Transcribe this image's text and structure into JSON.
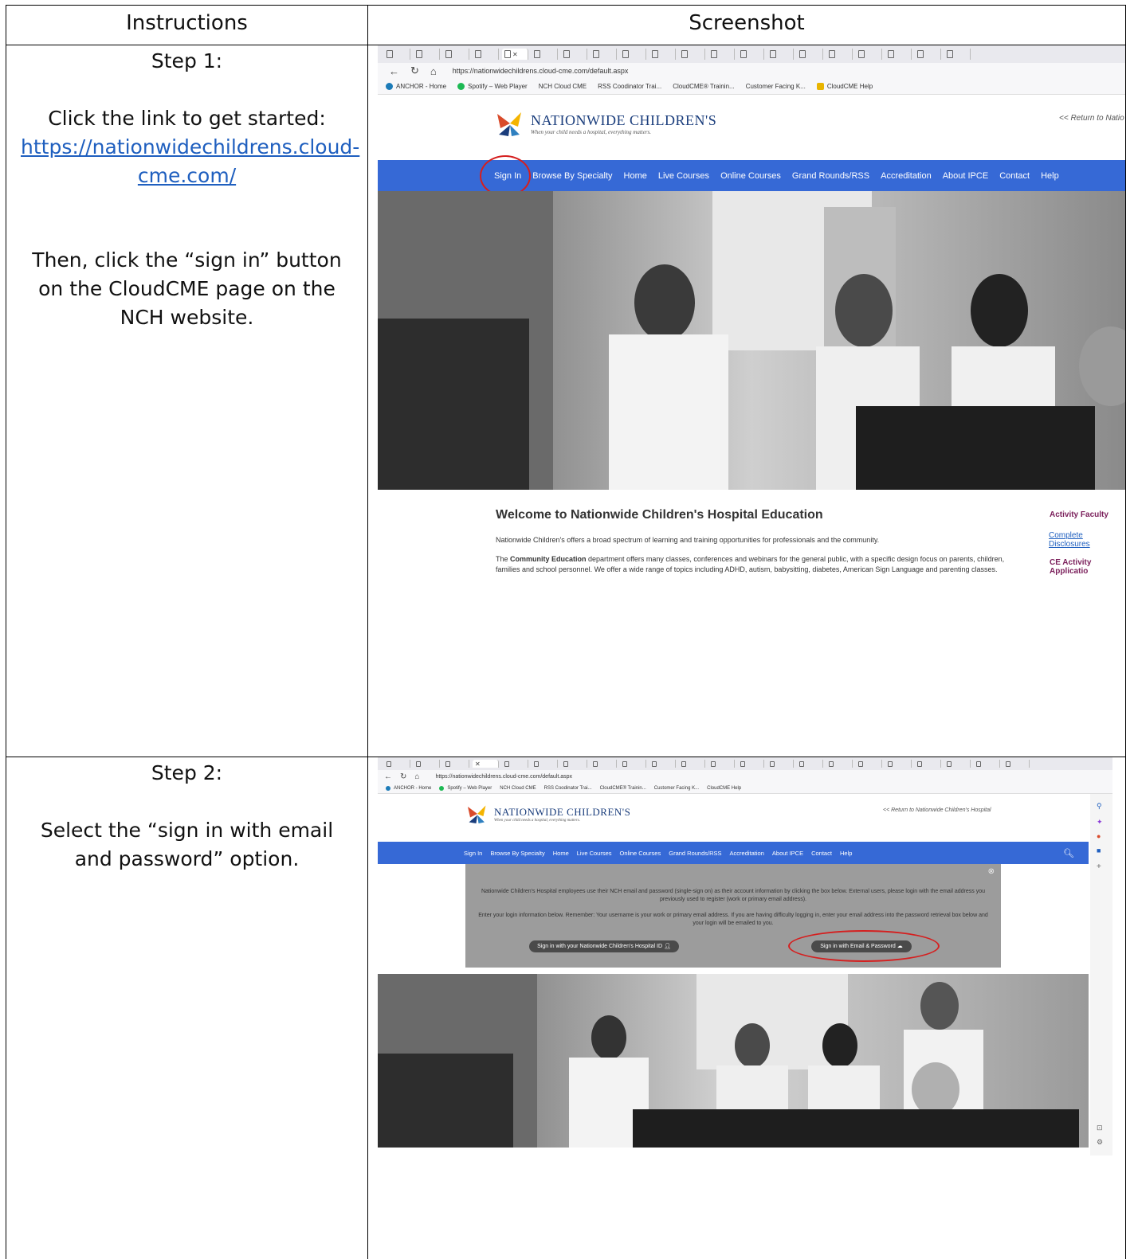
{
  "table": {
    "col1_header": "Instructions",
    "col2_header": "Screenshot"
  },
  "step1": {
    "title": "Step 1:",
    "text1": "Click the link to get started:",
    "link": "https://nationwidechildrens.cloud-cme.com/",
    "link_line1": "https://nationwidechildrens.cloud-",
    "link_line2": "cme.com/",
    "text2": "Then, click the “sign in” button on the CloudCME page on the NCH website."
  },
  "step2": {
    "title": "Step 2:",
    "text": "Select the “sign in with email and password” option."
  },
  "browser": {
    "url": "https://nationwidechildrens.cloud-cme.com/default.aspx",
    "bookmarks": [
      "ANCHOR - Home",
      "Spotify – Web Player",
      "NCH Cloud CME",
      "RSS Coodinator Trai...",
      "CloudCME® Trainin...",
      "Customer Facing K...",
      "CloudCME Help"
    ]
  },
  "site": {
    "logo_name": "NATIONWIDE CHILDREN'S",
    "logo_tagline": "When your child needs a hospital, everything matters.",
    "return_link_short": "<< Return to Natio",
    "return_link": "<< Return to Nationwide Children's Hospital",
    "nav": [
      "Sign In",
      "Browse By Specialty",
      "Home",
      "Live Courses",
      "Online Courses",
      "Grand Rounds/RSS",
      "Accreditation",
      "About IPCE",
      "Contact",
      "Help"
    ],
    "welcome_title": "Welcome to Nationwide Children's Hospital Education",
    "welcome_p1": "Nationwide Children's offers a broad spectrum of learning and training opportunities for professionals and the community.",
    "welcome_p2_bold": "Community Education",
    "welcome_p2_pre": "The ",
    "welcome_p2_post": " department offers many classes, conferences and webinars for the general public, with a specific design focus on parents, children,",
    "welcome_p3": "families and school personnel. We offer a wide range of topics including ADHD, autism, babysitting, diabetes, American Sign Language and parenting classes.",
    "side_title1": "Activity Faculty",
    "side_link1": "Complete Disclosures",
    "side_title2": "CE Activity Applicatio"
  },
  "modal": {
    "p1": "Nationwide Children's Hospital employees use their NCH email and password (single-sign on) as their account information by clicking the box below. External users, please login with the email address you previously used to register (work or primary email address).",
    "p2": "Enter your login information below. Remember: Your username is your work or primary email address. If you are having difficulty logging in, enter your email address into the password retrieval box below and your login will be emailed to you.",
    "btn_nch": "Sign in with your Nationwide Children's Hospital ID",
    "btn_email": "Sign in with Email & Password"
  },
  "colors": {
    "nav_blue": "#3669d6",
    "highlight_red": "#d51f1f",
    "link_blue": "#1f5fbf"
  }
}
